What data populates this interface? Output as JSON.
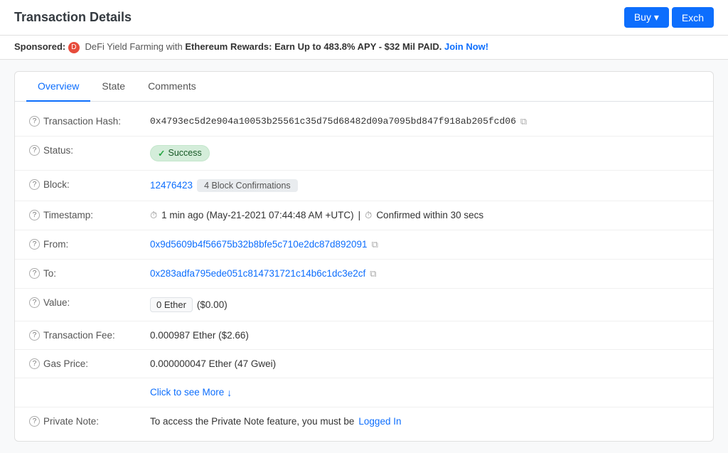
{
  "page": {
    "title": "Transaction Details"
  },
  "topbar": {
    "buy_label": "Buy ▾",
    "exchange_label": "Exch"
  },
  "sponsored": {
    "label": "Sponsored:",
    "icon_label": "D",
    "text_prefix": "DeFi Yield Farming with ",
    "text_bold": "Ethereum Rewards: Earn Up to 483.8% APY - $32 Mil PAID.",
    "join_text": "Join Now!"
  },
  "tabs": [
    {
      "id": "overview",
      "label": "Overview",
      "active": true
    },
    {
      "id": "state",
      "label": "State",
      "active": false
    },
    {
      "id": "comments",
      "label": "Comments",
      "active": false
    }
  ],
  "fields": {
    "transaction_hash": {
      "label": "Transaction Hash:",
      "value": "0x4793ec5d2e904a10053b25561c35d75d68482d09a7095bd847f918ab205fcd06"
    },
    "status": {
      "label": "Status:",
      "value": "Success"
    },
    "block": {
      "label": "Block:",
      "block_number": "12476423",
      "confirmations": "4 Block Confirmations"
    },
    "timestamp": {
      "label": "Timestamp:",
      "value": "1 min ago (May-21-2021 07:44:48 AM +UTC)",
      "confirm_text": "Confirmed within 30 secs"
    },
    "from": {
      "label": "From:",
      "value": "0x9d5609b4f56675b32b8bfe5c710e2dc87d892091"
    },
    "to": {
      "label": "To:",
      "value": "0x283adfa795ede051c814731721c14b6c1dc3e2cf"
    },
    "value": {
      "label": "Value:",
      "ether_value": "0 Ether",
      "usd_value": "($0.00)"
    },
    "transaction_fee": {
      "label": "Transaction Fee:",
      "value": "0.000987 Ether ($2.66)"
    },
    "gas_price": {
      "label": "Gas Price:",
      "value": "0.000000047 Ether (47 Gwei)"
    },
    "click_more": {
      "label": "Click to see More"
    },
    "private_note": {
      "label": "Private Note:",
      "text_prefix": "To access the Private Note feature, you must be ",
      "link_text": "Logged In"
    }
  }
}
